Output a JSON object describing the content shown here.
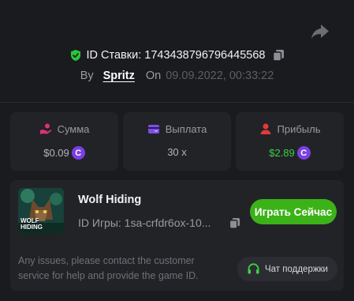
{
  "header": {
    "bet_id": "ID Ставки: 1743438796796445568",
    "by_label": "By",
    "username": "Spritz",
    "on_label": "On",
    "date": "09.09.2022, 00:33:22"
  },
  "icons": {
    "share": "share-arrow-icon",
    "verified": "shield-check-icon",
    "copy": "copy-icon",
    "coin": "coin-c-icon",
    "headset": "headset-icon"
  },
  "colors": {
    "background": "#1a1b1f",
    "card": "#222327",
    "accent_green": "#3cb219",
    "profit_green": "#3bd046",
    "coin_purple": "#7b3fe4",
    "amount_icon": "#e0317a",
    "payout_icon": "#7c4fe6",
    "profit_icon": "#e23a3a"
  },
  "stats": {
    "amount": {
      "label": "Сумма",
      "value": "$0.09",
      "coin": "C"
    },
    "payout": {
      "label": "Выплата",
      "value": "30 x"
    },
    "profit": {
      "label": "Прибыль",
      "value": "$2.89",
      "coin": "C"
    }
  },
  "game": {
    "title": "Wolf Hiding",
    "thumb_text_1": "WOLF",
    "thumb_text_2": "HIDING",
    "id_text": "ID Игры: 1sa-crfdr6ox-10...",
    "play_label": "Играть Сейчас",
    "issues_text": "Any issues, please contact the customer service for help and provide the game ID.",
    "support_label": "Чат поддержки"
  }
}
